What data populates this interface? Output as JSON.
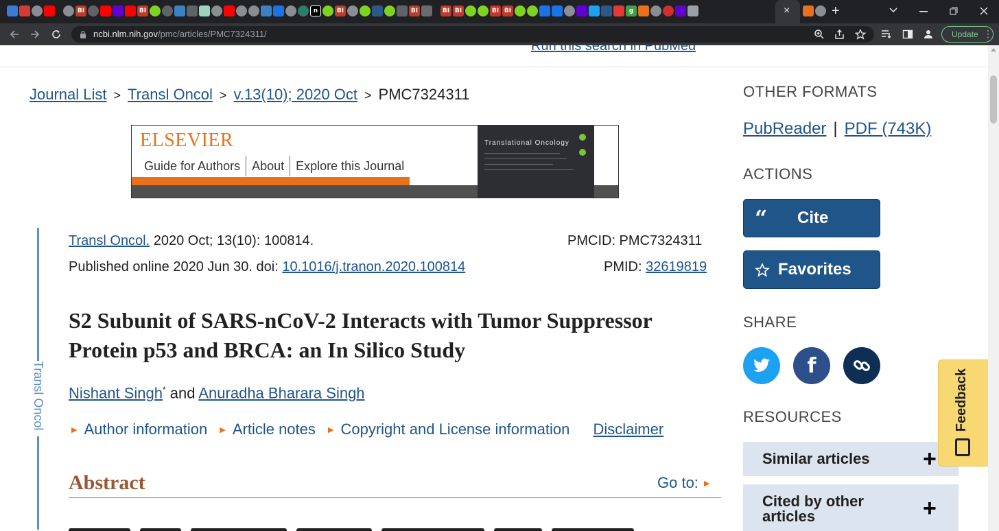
{
  "browser": {
    "url_host": "ncbi.nlm.nih.gov",
    "url_path": "/pmc/articles/PMC7324311/",
    "update_label": "Update",
    "tab_close": "×",
    "new_tab": "+",
    "favicon_labels": [
      "BI",
      "BI",
      "BI",
      "BI",
      "n",
      "BI",
      "BI",
      "BI",
      "BI",
      "BI",
      "g"
    ]
  },
  "page": {
    "top_link_cut": "Run this search in PubMed",
    "breadcrumb": {
      "items": [
        "Journal List",
        "Transl Oncol",
        "v.13(10); 2020 Oct"
      ],
      "separator": ">",
      "current": "PMC7324311"
    },
    "banner": {
      "logo": "ELSEVIER",
      "nav": [
        "Guide for Authors",
        "About",
        "Explore this Journal"
      ],
      "cover_title": "Translational Oncology"
    },
    "rail_label": "Transl Oncol",
    "citation": {
      "journal": "Transl Oncol.",
      "details": " 2020 Oct; 13(10): 100814.",
      "published_prefix": "Published online 2020 Jun 30. doi: ",
      "doi": "10.1016/j.tranon.2020.100814",
      "pmcid": "PMCID: PMC7324311",
      "pmid_label": "PMID: ",
      "pmid": "32619819"
    },
    "title": "S2 Subunit of SARS-nCoV-2 Interacts with Tumor Suppressor Protein p53 and BRCA: an In Silico Study",
    "authors": {
      "first": "Nishant Singh",
      "first_mark": "*",
      "joiner": " and ",
      "second": "Anuradha Bharara Singh"
    },
    "info_links": [
      "Author information",
      "Article notes",
      "Copyright and License information"
    ],
    "disclaimer": "Disclaimer",
    "abstract_heading": "Abstract",
    "goto": "Go to:"
  },
  "sidebar": {
    "other_formats_heading": "OTHER FORMATS",
    "pubreader": "PubReader",
    "format_sep": "|",
    "pdf": "PDF (743K)",
    "actions_heading": "ACTIONS",
    "cite_label": "Cite",
    "favorites_label": "Favorites",
    "share_heading": "SHARE",
    "resources_heading": "RESOURCES",
    "resources": [
      "Similar articles",
      "Cited by other articles"
    ],
    "feedback": "Feedback"
  },
  "colors": {
    "link": "#20558a",
    "accent_orange": "#e9711c",
    "twitter": "#1da1f2",
    "facebook": "#2d4f8a",
    "copy_link": "#0f2e54"
  }
}
